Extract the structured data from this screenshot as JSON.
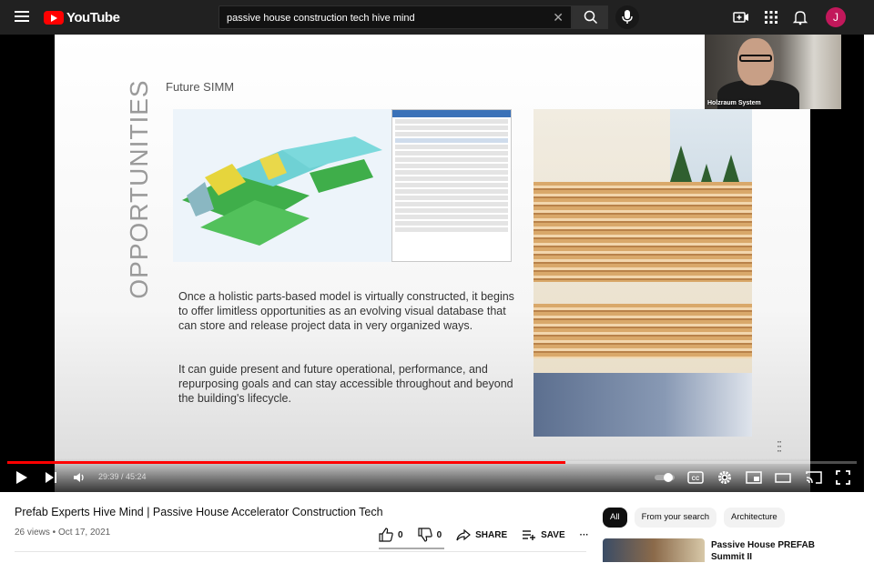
{
  "header": {
    "logo_text": "YouTube",
    "search_value": "passive house construction tech hive mind",
    "avatar_letter": "J"
  },
  "video": {
    "progress_fraction": 0.657,
    "time_display": "29:39 / 45:24",
    "webcam_label": "Holzraum System"
  },
  "slide": {
    "vertical_title": "OPPORTUNITIES",
    "subtitle": "Future SIMM",
    "paragraph_1": "Once a holistic parts-based model is virtually constructed, it begins to offer limitless opportunities as an evolving visual database that can store and release project data in very organized ways.",
    "paragraph_2": "It can guide present and future operational, performance, and repurposing goals and can stay accessible throughout and beyond the building's lifecycle."
  },
  "info": {
    "title": "Prefab Experts Hive Mind | Passive House Accelerator Construction Tech",
    "meta": "26 views • Oct 17, 2021",
    "likes": "0",
    "dislikes": "0",
    "share_label": "SHARE",
    "save_label": "SAVE",
    "more": "···"
  },
  "sidebar": {
    "chips": [
      "All",
      "From your search",
      "Architecture"
    ],
    "rec_title": "Passive House PREFAB Summit II"
  },
  "colors": {
    "brand_red": "#ff0000",
    "topbar": "#212121",
    "avatar": "#c2185b"
  }
}
